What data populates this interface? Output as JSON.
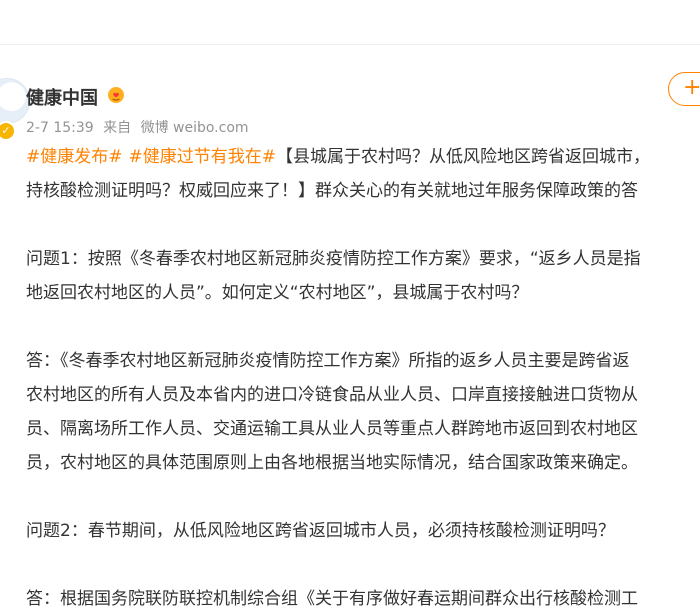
{
  "account": {
    "name": "健康中国",
    "timestamp": "2-7 15:39",
    "source_prefix": "来自",
    "source": "微博 weibo.com"
  },
  "follow_label": "+",
  "post": {
    "tags": [
      "#健康发布#",
      "#健康过节有我在#"
    ],
    "line1_text": "【县城属于农村吗？从低风险地区跨省返回城市，",
    "line2": "持核酸检测证明吗？权威回应来了！】群众关心的有关就地过年服务保障政策的答",
    "q1_line1": "问题1：按照《冬春季农村地区新冠肺炎疫情防控工作方案》要求，“返乡人员是指",
    "q1_line2": "地返回农村地区的人员”。如何定义“农村地区”，县城属于农村吗？",
    "a1_line1": "答：《冬春季农村地区新冠肺炎疫情防控工作方案》所指的返乡人员主要是跨省返",
    "a1_line2": "农村地区的所有人员及本省内的进口冷链食品从业人员、口岸直接接触进口货物从",
    "a1_line3": "员、隔离场所工作人员、交通运输工具从业人员等重点人群跨地市返回到农村地区",
    "a1_line4": "员，农村地区的具体范围原则上由各地根据当地实际情况，结合国家政策来确定。",
    "q2_line1": "问题2：春节期间，从低风险地区跨省返回城市人员，必须持核酸检测证明吗？",
    "a2_line1": "答：根据国务院联防联控机制综合组《关于有序做好春运期间群众出行核酸检测工"
  }
}
